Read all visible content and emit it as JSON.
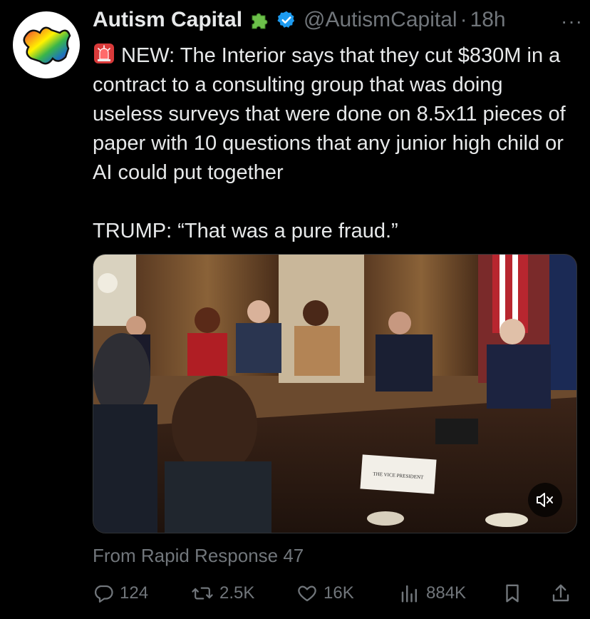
{
  "tweet": {
    "author_name": "Autism Capital",
    "author_handle": "@AutismCapital",
    "separator": "·",
    "time": "18h",
    "more_label": "···",
    "lines": [
      "NEW: The Interior says that they cut $830M in a contract to a consulting group that was doing useless surveys that were done on 8.5x11 pieces of paper with 10 questions that any junior high child or AI could put together",
      "TRUMP: “That was a pure fraud.”"
    ],
    "media_caption": "THE VICE PRESIDENT",
    "source": "From Rapid Response 47"
  },
  "actions": {
    "replies": "124",
    "reposts": "2.5K",
    "likes": "16K",
    "views": "884K"
  },
  "colors": {
    "background": "#000000",
    "text": "#e7e9ea",
    "muted": "#71767b",
    "verified": "#1d9bf0",
    "puzzle_green": "#6cc04a"
  },
  "icons": {
    "emoji_prefix": "siren-icon",
    "badge": "verified-icon",
    "emoji_after_name": "puzzle-piece-icon"
  }
}
